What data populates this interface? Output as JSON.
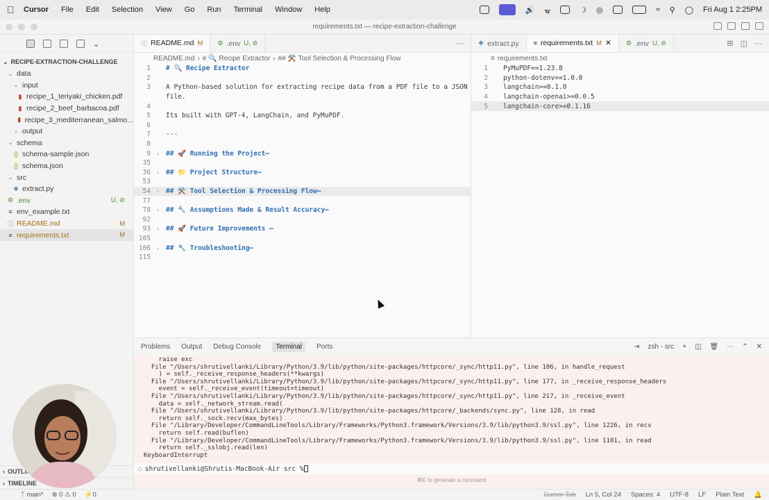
{
  "menubar": {
    "app": "Cursor",
    "items": [
      "File",
      "Edit",
      "Selection",
      "View",
      "Go",
      "Run",
      "Terminal",
      "Window",
      "Help"
    ],
    "clock": "Fri Aug 1  2:25PM"
  },
  "window": {
    "title": "requirements.txt — recipe-extraction-challenge"
  },
  "sidebar": {
    "project": "RECIPE-EXTRACTION-CHALLENGE",
    "tree": [
      {
        "label": "data",
        "kind": "folder",
        "depth": 0
      },
      {
        "label": "input",
        "kind": "folder",
        "depth": 1
      },
      {
        "label": "recipe_1_teriyaki_chicken.pdf",
        "kind": "pdf",
        "depth": 2
      },
      {
        "label": "recipe_2_beef_barbacoa.pdf",
        "kind": "pdf",
        "depth": 2
      },
      {
        "label": "recipe_3_mediterranean_salmo...",
        "kind": "pdf",
        "depth": 2
      },
      {
        "label": "output",
        "kind": "folder",
        "depth": 1
      },
      {
        "label": "schema",
        "kind": "folder",
        "depth": 0
      },
      {
        "label": "schema-sample.json",
        "kind": "json",
        "depth": 1
      },
      {
        "label": "schema.json",
        "kind": "json",
        "depth": 1
      },
      {
        "label": "src",
        "kind": "folder",
        "depth": 0
      },
      {
        "label": "extract.py",
        "kind": "py",
        "depth": 1
      },
      {
        "label": ".env",
        "kind": "env",
        "depth": 0,
        "badge": "U, ⊘"
      },
      {
        "label": "env_example.txt",
        "kind": "txt",
        "depth": 0
      },
      {
        "label": "README.md",
        "kind": "md",
        "depth": 0,
        "badge": "M"
      },
      {
        "label": "requirements.txt",
        "kind": "txt",
        "depth": 0,
        "badge": "M",
        "selected": true
      }
    ],
    "outline": "OUTLINE",
    "timeline": "TIMELINE"
  },
  "editor_left": {
    "tabs": [
      {
        "label": "README.md",
        "badge": "M",
        "active": true
      },
      {
        "label": ".env",
        "badge": "U, ⊘",
        "active": false
      }
    ],
    "breadcrumb": [
      "README.md",
      "# 🔍 Recipe Extractor",
      "## ⚒️ Tool Selection & Processing Flow"
    ],
    "lines": [
      {
        "n": "1",
        "text": "# 🔍 Recipe Extractor",
        "heading": true
      },
      {
        "n": "2",
        "text": ""
      },
      {
        "n": "3",
        "text": "A Python-based solution for extracting recipe data from a PDF file to a JSON"
      },
      {
        "n": "",
        "text": "file."
      },
      {
        "n": "4",
        "text": ""
      },
      {
        "n": "5",
        "text": "Its built with GPT-4, LangChain, and PyMuPDF."
      },
      {
        "n": "6",
        "text": ""
      },
      {
        "n": "7",
        "text": "---"
      },
      {
        "n": "8",
        "text": ""
      },
      {
        "n": "9",
        "text": "## 🚀 Running the Project⋯",
        "heading": true,
        "fold": true
      },
      {
        "n": "35",
        "text": ""
      },
      {
        "n": "36",
        "text": "## 📁 Project Structure⋯",
        "heading": true,
        "fold": true
      },
      {
        "n": "53",
        "text": ""
      },
      {
        "n": "54",
        "text": "## ⚒️ Tool Selection & Processing Flow⋯",
        "heading": true,
        "fold": true,
        "highlight": true
      },
      {
        "n": "77",
        "text": ""
      },
      {
        "n": "78",
        "text": "## 🔧 Assumptions Made & Result Accuracy⋯",
        "heading": true,
        "fold": true
      },
      {
        "n": "92",
        "text": ""
      },
      {
        "n": "93",
        "text": "## 🚀 Future Improvements ⋯",
        "heading": true,
        "fold": true
      },
      {
        "n": "105",
        "text": ""
      },
      {
        "n": "106",
        "text": "## 🔧 Troubleshooting⋯",
        "heading": true,
        "fold": true
      },
      {
        "n": "115",
        "text": ""
      }
    ]
  },
  "editor_right": {
    "tabs": [
      {
        "label": "extract.py",
        "badge": "",
        "active": false
      },
      {
        "label": "requirements.txt",
        "badge": "M",
        "active": true
      },
      {
        "label": ".env",
        "badge": "U, ⊘",
        "active": false
      }
    ],
    "breadcrumb": "requirements.txt",
    "lines": [
      {
        "n": "1",
        "text": "PyMuPDF==1.23.8"
      },
      {
        "n": "2",
        "text": "python-dotenv==1.0.0"
      },
      {
        "n": "3",
        "text": "langchain>=0.1.0"
      },
      {
        "n": "4",
        "text": "langchain-openai>=0.0.5"
      },
      {
        "n": "5",
        "text": "langchain-core>=0.1.16",
        "highlight": true
      }
    ]
  },
  "panel": {
    "tabs": [
      "Problems",
      "Output",
      "Debug Console",
      "Terminal",
      "Ports"
    ],
    "active_tab": "Terminal",
    "shell_label": "zsh - src",
    "terminal_lines": [
      "    raise exc",
      "  File \"/Users/shrutivellanki/Library/Python/3.9/lib/python/site-packages/httpcore/_sync/http11.py\", line 106, in handle_request",
      "    ) = self._receive_response_headers(**kwargs)",
      "  File \"/Users/shrutivellanki/Library/Python/3.9/lib/python/site-packages/httpcore/_sync/http11.py\", line 177, in _receive_response_headers",
      "    event = self._receive_event(timeout=timeout)",
      "  File \"/Users/shrutivellanki/Library/Python/3.9/lib/python/site-packages/httpcore/_sync/http11.py\", line 217, in _receive_event",
      "    data = self._network_stream.read(",
      "  File \"/Users/shrutivellanki/Library/Python/3.9/lib/python/site-packages/httpcore/_backends/sync.py\", line 128, in read",
      "    return self._sock.recv(max_bytes)",
      "  File \"/Library/Developer/CommandLineTools/Library/Frameworks/Python3.framework/Versions/3.9/lib/python3.9/ssl.py\", line 1226, in recv",
      "    return self.read(buflen)",
      "  File \"/Library/Developer/CommandLineTools/Library/Frameworks/Python3.framework/Versions/3.9/lib/python3.9/ssl.py\", line 1101, in read",
      "    return self._sslobj.read(len)",
      "KeyboardInterrupt"
    ],
    "prompt": "shrutivellanki@Shrutis-MacBook-Air src % ",
    "hint": "⌘K to generate a command"
  },
  "statusbar": {
    "branch": "main*",
    "errors": "⊗ 0 ⚠ 0",
    "ports": "⚡0",
    "cursor_tab": "Cursor Tab",
    "position": "Ln 5, Col 24",
    "spaces": "Spaces: 4",
    "encoding": "UTF-8",
    "eol": "LF",
    "language": "Plain Text"
  },
  "colors": {
    "accent": "#5b5bd6",
    "heading": "#2f6fb3",
    "terminal_bg": "#fcf0ee"
  }
}
